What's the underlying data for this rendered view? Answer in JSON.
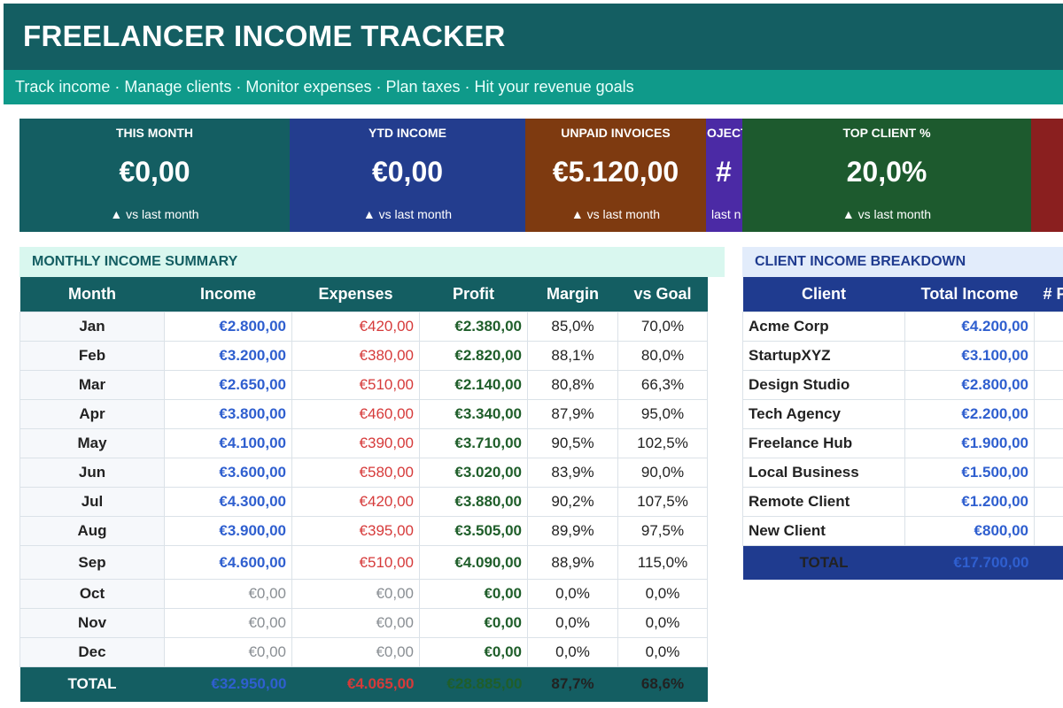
{
  "header": {
    "title": "FREELANCER INCOME TRACKER",
    "subtitle": "Track income · Manage clients · Monitor expenses · Plan taxes · Hit your revenue goals"
  },
  "colors": {
    "header_bg": "#145e62",
    "subbar_bg": "#0f9a8a",
    "income_blue": "#2f5fcf",
    "expense_red": "#d63a3a",
    "profit_green": "#1f5e2a",
    "client_header": "#1f3b8f"
  },
  "kpis": [
    {
      "title": "THIS MONTH",
      "value": "€0,00",
      "caption": "▲ vs last month",
      "color": "#145e62"
    },
    {
      "title": "YTD INCOME",
      "value": "€0,00",
      "caption": "▲ vs last month",
      "color": "#233d8e"
    },
    {
      "title": "UNPAID INVOICES",
      "value": "€5.120,00",
      "caption": "▲ vs last month",
      "color": "#7e3a10"
    },
    {
      "title": "OJECT",
      "value": "#",
      "caption": "last n",
      "color": "#4b2aa5"
    },
    {
      "title": "TOP CLIENT %",
      "value": "20,0%",
      "caption": "▲ vs last month",
      "color": "#1d5a2e"
    },
    {
      "title": "",
      "value": "",
      "caption": "",
      "color": "#8a1f1f"
    }
  ],
  "monthly": {
    "title": "MONTHLY INCOME SUMMARY",
    "columns": [
      "Month",
      "Income",
      "Expenses",
      "Profit",
      "Margin",
      "vs Goal"
    ],
    "rows": [
      [
        "Jan",
        "€2.800,00",
        "€420,00",
        "€2.380,00",
        "85,0%",
        "70,0%"
      ],
      [
        "Feb",
        "€3.200,00",
        "€380,00",
        "€2.820,00",
        "88,1%",
        "80,0%"
      ],
      [
        "Mar",
        "€2.650,00",
        "€510,00",
        "€2.140,00",
        "80,8%",
        "66,3%"
      ],
      [
        "Apr",
        "€3.800,00",
        "€460,00",
        "€3.340,00",
        "87,9%",
        "95,0%"
      ],
      [
        "May",
        "€4.100,00",
        "€390,00",
        "€3.710,00",
        "90,5%",
        "102,5%"
      ],
      [
        "Jun",
        "€3.600,00",
        "€580,00",
        "€3.020,00",
        "83,9%",
        "90,0%"
      ],
      [
        "Jul",
        "€4.300,00",
        "€420,00",
        "€3.880,00",
        "90,2%",
        "107,5%"
      ],
      [
        "Aug",
        "€3.900,00",
        "€395,00",
        "€3.505,00",
        "89,9%",
        "97,5%"
      ],
      [
        "Sep",
        "€4.600,00",
        "€510,00",
        "€4.090,00",
        "88,9%",
        "115,0%"
      ],
      [
        "Oct",
        "€0,00",
        "€0,00",
        "€0,00",
        "0,0%",
        "0,0%"
      ],
      [
        "Nov",
        "€0,00",
        "€0,00",
        "€0,00",
        "0,0%",
        "0,0%"
      ],
      [
        "Dec",
        "€0,00",
        "€0,00",
        "€0,00",
        "0,0%",
        "0,0%"
      ]
    ],
    "total": [
      "TOTAL",
      "€32.950,00",
      "€4.065,00",
      "€28.885,00",
      "87,7%",
      "68,6%"
    ]
  },
  "clients": {
    "title": "CLIENT INCOME BREAKDOWN",
    "columns": [
      "Client",
      "Total Income",
      "# P"
    ],
    "rows": [
      [
        "Acme Corp",
        "€4.200,00"
      ],
      [
        "StartupXYZ",
        "€3.100,00"
      ],
      [
        "Design Studio",
        "€2.800,00"
      ],
      [
        "Tech Agency",
        "€2.200,00"
      ],
      [
        "Freelance Hub",
        "€1.900,00"
      ],
      [
        "Local Business",
        "€1.500,00"
      ],
      [
        "Remote Client",
        "€1.200,00"
      ],
      [
        "New Client",
        "€800,00"
      ]
    ],
    "total": [
      "TOTAL",
      "€17.700,00"
    ]
  }
}
